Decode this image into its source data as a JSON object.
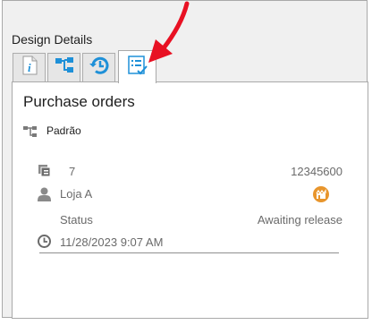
{
  "panel": {
    "title": "Design Details"
  },
  "tabs": [
    {
      "icon": "info-icon"
    },
    {
      "icon": "hierarchy-icon"
    },
    {
      "icon": "history-icon"
    },
    {
      "icon": "checklist-icon"
    }
  ],
  "detail": {
    "heading": "Purchase orders",
    "category": "Padrão",
    "count": "7",
    "number": "12345600",
    "store": "Loja A",
    "status_label": "Status",
    "status_value": "Awaiting release",
    "timestamp": "11/28/2023 9:07 AM"
  },
  "colors": {
    "accent_blue": "#1e90d8",
    "annotation_red": "#e81123",
    "store_badge": "#e8952c"
  }
}
